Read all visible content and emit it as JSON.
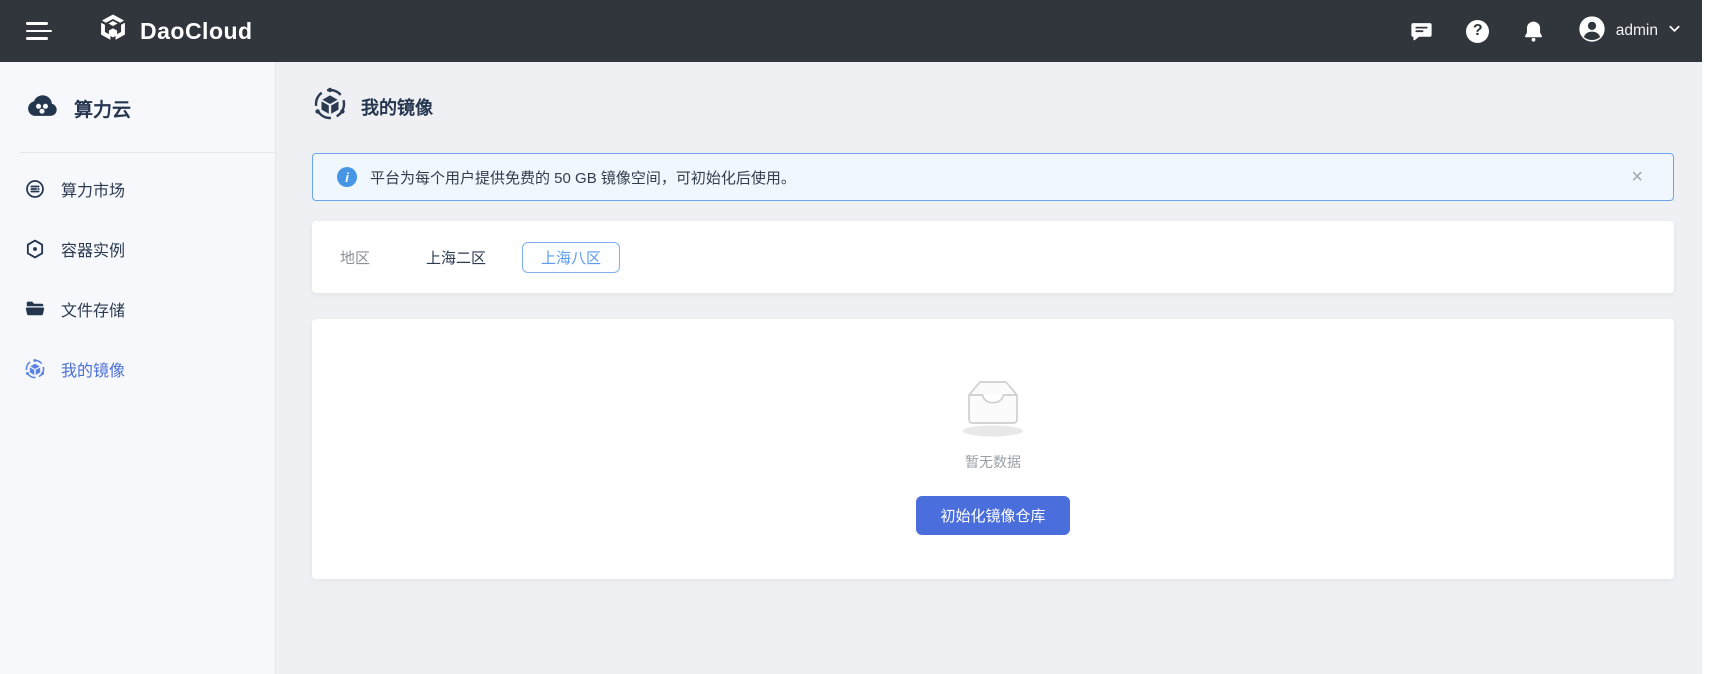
{
  "topbar": {
    "brand": "DaoCloud",
    "user": "admin"
  },
  "sidebar": {
    "brand": "算力云",
    "items": [
      {
        "label": "算力市场",
        "active": false
      },
      {
        "label": "容器实例",
        "active": false
      },
      {
        "label": "文件存储",
        "active": false
      },
      {
        "label": "我的镜像",
        "active": true
      }
    ]
  },
  "main": {
    "title": "我的镜像",
    "banner": {
      "text": "平台为每个用户提供免费的 50 GB 镜像空间，可初始化后使用。",
      "close_label": "×"
    },
    "region": {
      "label": "地区",
      "options": [
        {
          "label": "上海二区",
          "selected": false
        },
        {
          "label": "上海八区",
          "selected": true
        }
      ]
    },
    "empty": {
      "text": "暂无数据",
      "button_label": "初始化镜像仓库"
    }
  },
  "colors": {
    "topbar_bg": "#31353c",
    "sidebar_bg": "#f7f8fb",
    "page_bg": "#eef0f4",
    "accent_blue": "#4a6edb",
    "active_nav_blue": "#4b6fd8",
    "banner_border": "#6ba4e9",
    "banner_bg": "#f0f7fe",
    "info_icon_blue": "#4796e6",
    "region_pill_blue": "#5d9cf0",
    "dark_text": "#2b3a50",
    "muted_text": "#9aa0a8"
  }
}
